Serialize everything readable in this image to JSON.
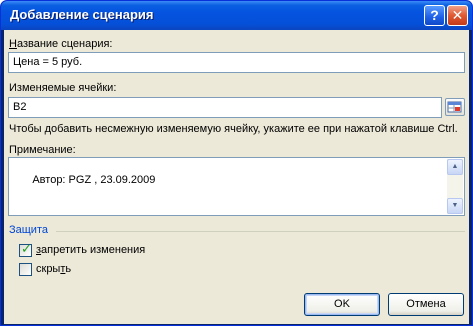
{
  "window": {
    "title": "Добавление сценария"
  },
  "scenario_name": {
    "label": "Название сценария:",
    "value": "Цена = 5 руб."
  },
  "changing_cells": {
    "label": "Изменяемые ячейки:",
    "value": "B2",
    "hint": "Чтобы добавить несмежную изменяемую ячейку, укажите ее при нажатой клавише Ctrl."
  },
  "comment": {
    "label": "Примечание:",
    "value": "Автор: PGZ , 23.09.2009"
  },
  "protection": {
    "group_label": "Защита",
    "prevent_changes": {
      "label": "запретить изменения",
      "checked": true
    },
    "hide": {
      "label": "скрыть",
      "checked": false
    }
  },
  "buttons": {
    "ok": "OK",
    "cancel": "Отмена"
  }
}
